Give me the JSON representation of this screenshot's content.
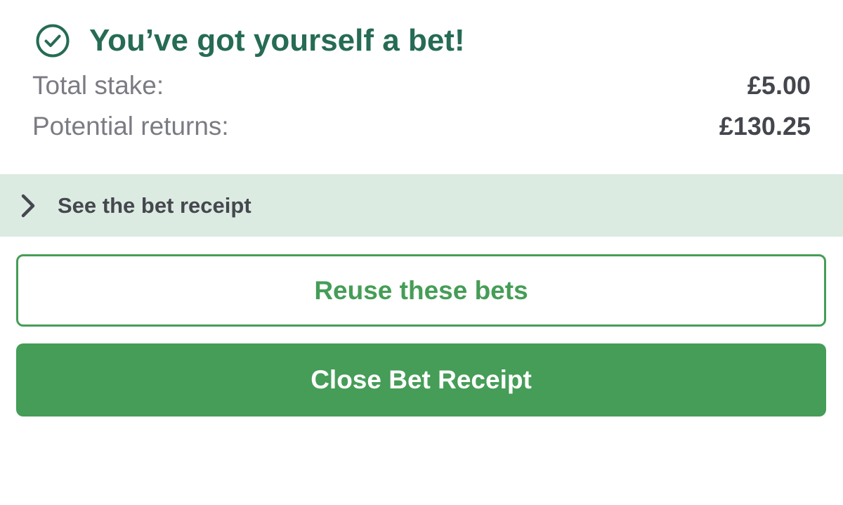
{
  "confirmation": {
    "icon": "check-circle-icon",
    "headline": "You’ve got yourself a bet!",
    "headline_color": "#266b55"
  },
  "summary": {
    "stake_label": "Total stake:",
    "stake_value": "£5.00",
    "returns_label": "Potential returns:",
    "returns_value": "£130.25"
  },
  "receipt_toggle": {
    "icon": "chevron-right-icon",
    "label": "See the bet receipt",
    "background": "#dcebe2"
  },
  "actions": {
    "reuse_label": "Reuse these bets",
    "close_label": "Close Bet Receipt",
    "accent_color": "#459d57"
  }
}
